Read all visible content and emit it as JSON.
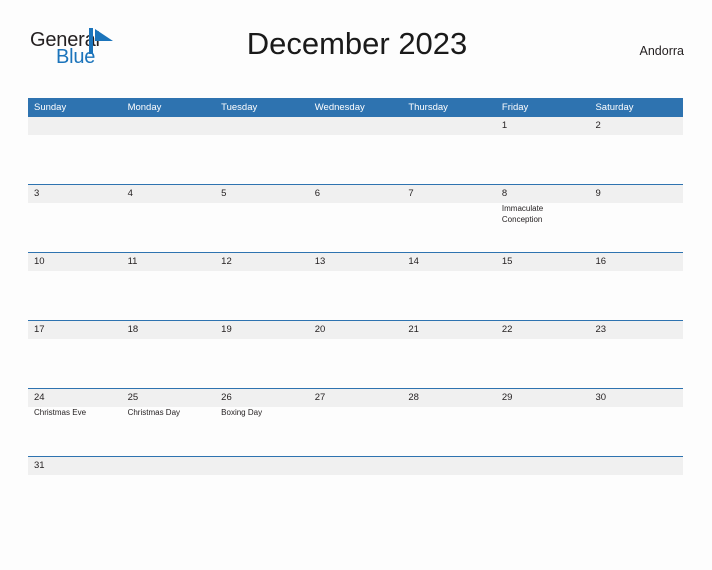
{
  "brand": {
    "name_part1": "General",
    "name_part2": "Blue",
    "mark": "sail-triangle-logo"
  },
  "header": {
    "title": "December 2023",
    "region": "Andorra"
  },
  "calendar": {
    "weekday_headers": [
      "Sunday",
      "Monday",
      "Tuesday",
      "Wednesday",
      "Thursday",
      "Friday",
      "Saturday"
    ],
    "accent_color": "#2e73b0",
    "band_color": "#f0f0f0",
    "weeks": [
      {
        "short": false,
        "days": [
          {
            "num": "",
            "events": []
          },
          {
            "num": "",
            "events": []
          },
          {
            "num": "",
            "events": []
          },
          {
            "num": "",
            "events": []
          },
          {
            "num": "",
            "events": []
          },
          {
            "num": "1",
            "events": []
          },
          {
            "num": "2",
            "events": []
          }
        ]
      },
      {
        "short": false,
        "days": [
          {
            "num": "3",
            "events": []
          },
          {
            "num": "4",
            "events": []
          },
          {
            "num": "5",
            "events": []
          },
          {
            "num": "6",
            "events": []
          },
          {
            "num": "7",
            "events": []
          },
          {
            "num": "8",
            "events": [
              "Immaculate Conception"
            ]
          },
          {
            "num": "9",
            "events": []
          }
        ]
      },
      {
        "short": false,
        "days": [
          {
            "num": "10",
            "events": []
          },
          {
            "num": "11",
            "events": []
          },
          {
            "num": "12",
            "events": []
          },
          {
            "num": "13",
            "events": []
          },
          {
            "num": "14",
            "events": []
          },
          {
            "num": "15",
            "events": []
          },
          {
            "num": "16",
            "events": []
          }
        ]
      },
      {
        "short": false,
        "days": [
          {
            "num": "17",
            "events": []
          },
          {
            "num": "18",
            "events": []
          },
          {
            "num": "19",
            "events": []
          },
          {
            "num": "20",
            "events": []
          },
          {
            "num": "21",
            "events": []
          },
          {
            "num": "22",
            "events": []
          },
          {
            "num": "23",
            "events": []
          }
        ]
      },
      {
        "short": false,
        "days": [
          {
            "num": "24",
            "events": [
              "Christmas Eve"
            ]
          },
          {
            "num": "25",
            "events": [
              "Christmas Day"
            ]
          },
          {
            "num": "26",
            "events": [
              "Boxing Day"
            ]
          },
          {
            "num": "27",
            "events": []
          },
          {
            "num": "28",
            "events": []
          },
          {
            "num": "29",
            "events": []
          },
          {
            "num": "30",
            "events": []
          }
        ]
      },
      {
        "short": true,
        "days": [
          {
            "num": "31",
            "events": []
          },
          {
            "num": "",
            "events": []
          },
          {
            "num": "",
            "events": []
          },
          {
            "num": "",
            "events": []
          },
          {
            "num": "",
            "events": []
          },
          {
            "num": "",
            "events": []
          },
          {
            "num": "",
            "events": []
          }
        ]
      }
    ]
  }
}
